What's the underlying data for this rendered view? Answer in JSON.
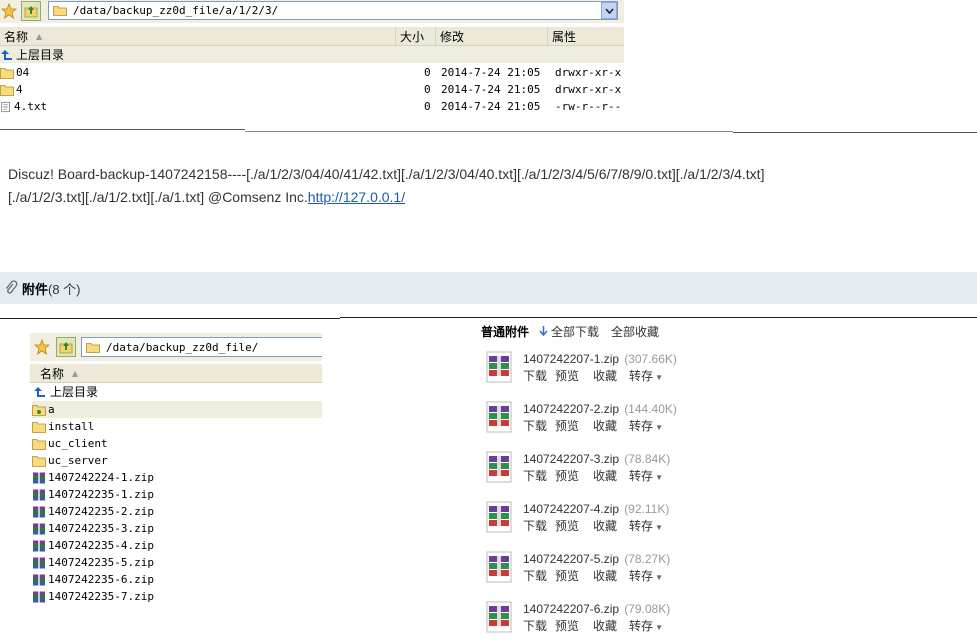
{
  "top_pane": {
    "address": "/data/backup_zz0d_file/a/1/2/3/",
    "headers": {
      "name": "名称",
      "size": "大小",
      "modified": "修改",
      "attrs": "属性"
    },
    "up_label": "上层目录",
    "rows": [
      {
        "name": "04",
        "size": "0",
        "modified": "2014-7-24 21:05",
        "attrs": "drwxr-xr-x",
        "type": "folder"
      },
      {
        "name": "4",
        "size": "0",
        "modified": "2014-7-24 21:05",
        "attrs": "drwxr-xr-x",
        "type": "folder"
      },
      {
        "name": "4.txt",
        "size": "0",
        "modified": "2014-7-24 21:05",
        "attrs": "-rw-r--r--",
        "type": "file"
      }
    ]
  },
  "post": {
    "line1": "Discuz! Board-backup-1407242158----[./a/1/2/3/04/40/41/42.txt][./a/1/2/3/04/40.txt][./a/1/2/3/4/5/6/7/8/9/0.txt][./a/1/2/3/4.txt]",
    "line2_text": "[./a/1/2/3.txt][./a/1/2.txt][./a/1.txt] @Comsenz Inc.",
    "line2_link": "http://127.0.0.1/"
  },
  "attachments_bar": {
    "label": "附件",
    "count": "(8 个)"
  },
  "bottom_pane": {
    "address": "/data/backup_zz0d_file/",
    "header_name": "名称",
    "up_label": "上层目录",
    "items": [
      {
        "name": "a",
        "type": "folder-lock"
      },
      {
        "name": "install",
        "type": "folder"
      },
      {
        "name": "uc_client",
        "type": "folder"
      },
      {
        "name": "uc_server",
        "type": "folder"
      },
      {
        "name": "1407242224-1.zip",
        "type": "zip"
      },
      {
        "name": "1407242235-1.zip",
        "type": "zip"
      },
      {
        "name": "1407242235-2.zip",
        "type": "zip"
      },
      {
        "name": "1407242235-3.zip",
        "type": "zip"
      },
      {
        "name": "1407242235-4.zip",
        "type": "zip"
      },
      {
        "name": "1407242235-5.zip",
        "type": "zip"
      },
      {
        "name": "1407242235-6.zip",
        "type": "zip"
      },
      {
        "name": "1407242235-7.zip",
        "type": "zip"
      }
    ]
  },
  "attach_list": {
    "title": "普通附件",
    "download_all": "全部下载",
    "collect_all": "全部收藏",
    "actions": {
      "download": "下载",
      "preview": "预览",
      "collect": "收藏",
      "forward": "转存"
    },
    "files": [
      {
        "name": "1407242207-1.zip",
        "size": "(307.66K)"
      },
      {
        "name": "1407242207-2.zip",
        "size": "(144.40K)"
      },
      {
        "name": "1407242207-3.zip",
        "size": "(78.84K)"
      },
      {
        "name": "1407242207-4.zip",
        "size": "(92.11K)"
      },
      {
        "name": "1407242207-5.zip",
        "size": "(78.27K)"
      },
      {
        "name": "1407242207-6.zip",
        "size": "(79.08K)"
      }
    ]
  }
}
